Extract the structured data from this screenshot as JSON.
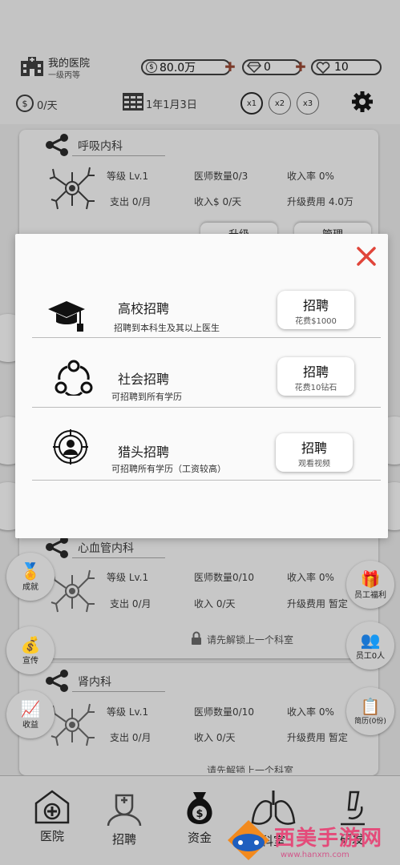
{
  "header": {
    "hospital_name": "我的医院",
    "hospital_rank": "一级丙等",
    "money": "80.0万",
    "diamonds": "0",
    "hearts": "10",
    "income": "0/天",
    "date": "1年1月3日",
    "speeds": [
      "x1",
      "x2",
      "x3"
    ],
    "money_icon": "$",
    "income_icon": "$"
  },
  "departments": [
    {
      "name": "呼吸内科",
      "level_label": "等级 Lv.1",
      "doctors_label": "医师数量0/3",
      "income_rate_label": "收入率 0%",
      "expense_label": "支出 0/月",
      "income_label": "收入$ 0/天",
      "upgrade_label": "升级费用 4.0万",
      "btn_upgrade": "升级",
      "btn_manage": "管理"
    },
    {
      "name": "心血管内科",
      "level_label": "等级 Lv.1",
      "doctors_label": "医师数量0/10",
      "income_rate_label": "收入率 0%",
      "expense_label": "支出 0/月",
      "income_label": "收入 0/天",
      "upgrade_label": "升级费用 暂定",
      "lock_text": "请先解锁上一个科室"
    },
    {
      "name": "肾内科",
      "level_label": "等级 Lv.1",
      "doctors_label": "医师数量0/10",
      "income_rate_label": "收入率 0%",
      "expense_label": "支出 0/月",
      "income_label": "收入 0/天",
      "upgrade_label": "升级费用 暂定",
      "lock_text": "请先解锁上一个科室"
    }
  ],
  "side_left": [
    "成就",
    "宣传",
    "收益"
  ],
  "side_right": [
    "员工福利",
    "员工0人",
    "简历(0份)"
  ],
  "nav": [
    "医院",
    "招聘",
    "资金",
    "科室",
    "研发"
  ],
  "modal": {
    "rows": [
      {
        "title": "高校招聘",
        "desc": "招聘到本科生及其以上医生",
        "btn": "招聘",
        "btn_sub": "花费$1000",
        "icon": "graduation-cap-icon"
      },
      {
        "title": "社会招聘",
        "desc": "可招聘到所有学历",
        "btn": "招聘",
        "btn_sub": "花费10钻石",
        "icon": "network-icon"
      },
      {
        "title": "猎头招聘",
        "desc": "可招聘所有学历（工资较高）",
        "btn": "招聘",
        "btn_sub": "观看视频",
        "icon": "headhunter-icon"
      }
    ]
  },
  "watermark": {
    "text": "西美手游网",
    "url": "www.hanxm.com"
  },
  "colors": {
    "close": "#e0453a",
    "plus": "#7a3a2a",
    "watermark": "#e44b7a"
  }
}
